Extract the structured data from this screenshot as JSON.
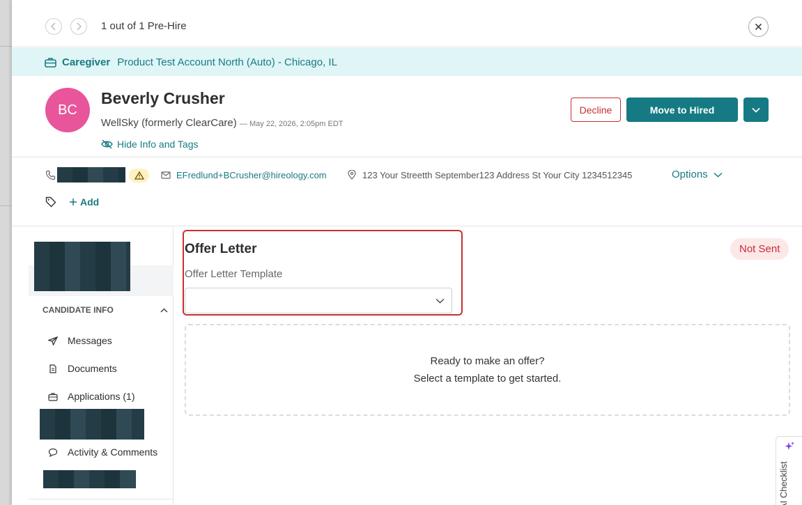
{
  "header": {
    "counter_text": "1 out of 1 Pre-Hire"
  },
  "job": {
    "role": "Caregiver",
    "location": "Product Test Account North (Auto) - Chicago, IL"
  },
  "candidate": {
    "initials": "BC",
    "name": "Beverly Crusher",
    "company": "WellSky (formerly ClearCare)",
    "date": "— May 22, 2026, 2:05pm EDT",
    "hide_info_label": "Hide Info and Tags",
    "email": "EFredlund+BCrusher@hireology.com",
    "address": "123 Your Streetth September123 Address St Your City 1234512345"
  },
  "actions": {
    "decline": "Decline",
    "move_to_hired": "Move to Hired",
    "options": "Options",
    "add_tag": "Add"
  },
  "sidebar": {
    "section_header": "CANDIDATE INFO",
    "items": [
      {
        "label": "Messages",
        "icon": "send-icon"
      },
      {
        "label": "Documents",
        "icon": "document-icon"
      },
      {
        "label": "Applications (1)",
        "icon": "briefcase-icon"
      },
      {
        "label": "Activity & Comments",
        "icon": "comment-icon"
      }
    ]
  },
  "offer": {
    "title": "Offer Letter",
    "template_label": "Offer Letter Template",
    "template_value": "",
    "status": "Not Sent",
    "empty_line1": "Ready to make an offer?",
    "empty_line2": "Select a template to get started."
  },
  "ai_tab": {
    "label": "AI Checklist"
  },
  "colors": {
    "accent": "#157a83",
    "danger": "#c62f32",
    "avatar": "#e8559a",
    "banner_bg": "#dff5f6"
  }
}
